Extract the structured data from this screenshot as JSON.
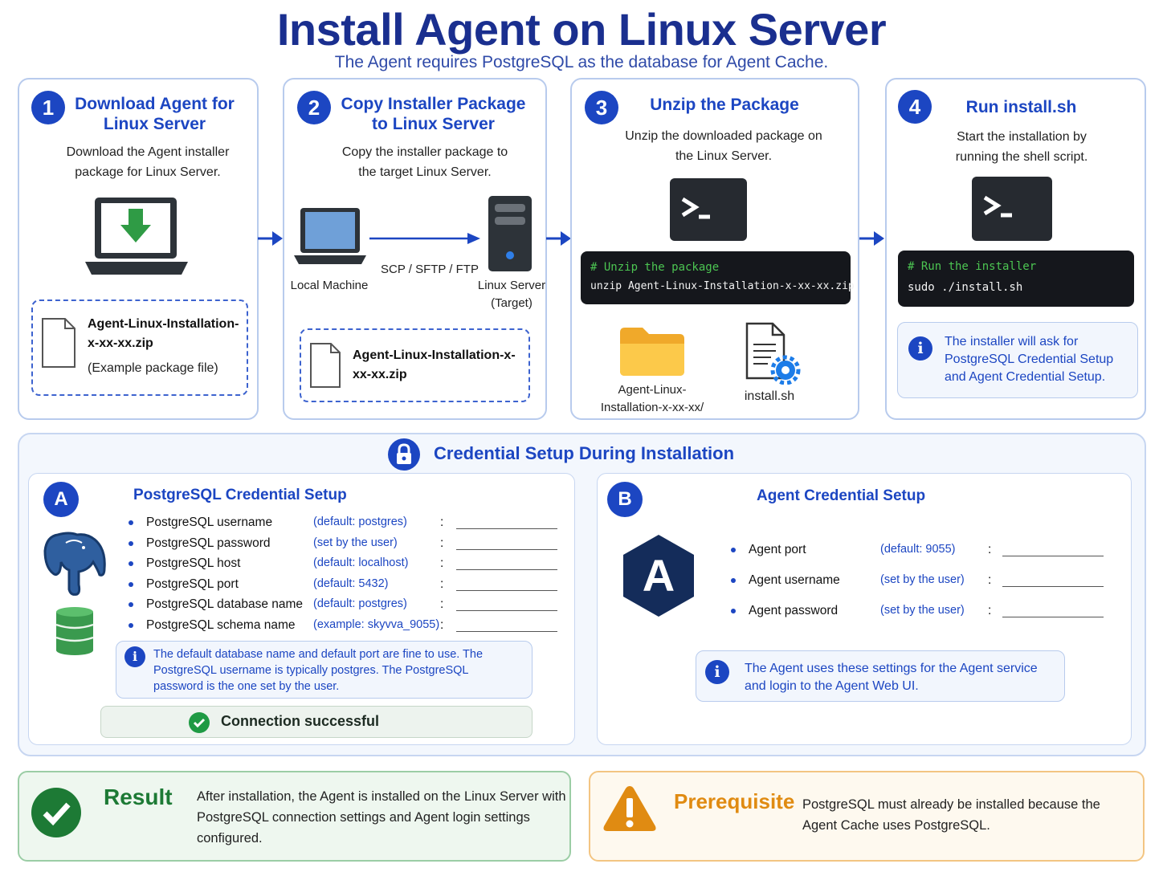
{
  "header": {
    "title": "Install Agent on Linux Server",
    "subtitle": "The Agent requires PostgreSQL as the database for Agent Cache."
  },
  "steps": [
    {
      "number": "1",
      "title": "Download Agent for Linux Server",
      "description": "Download the Agent installer package for Linux Server.",
      "file_name": "Agent-Linux-Installation-x-xx-xx.zip",
      "file_note": "(Example package file)",
      "icon": "laptop-download-icon"
    },
    {
      "number": "2",
      "title": "Copy Installer Package to Linux Server",
      "description": "Copy the installer package to the target Linux Server.",
      "local_label": "Local Machine",
      "transfer_label": "SCP / SFTP / FTP",
      "server_label": "Linux Server (Target)",
      "file_name": "Agent-Linux-Installation-x-xx-xx.zip"
    },
    {
      "number": "3",
      "title": "Unzip the Package",
      "description": "Unzip the downloaded package on the Linux Server.",
      "code_comment": "# Unzip the package",
      "code_command": "unzip Agent-Linux-Installation-x-xx-xx.zip",
      "folder_label": "Agent-Linux-Installation-x-xx-xx/",
      "script_label": "install.sh"
    },
    {
      "number": "4",
      "title": "Run install.sh",
      "description": "Start the installation by running the shell script.",
      "code_comment": "# Run the installer",
      "code_command": "sudo ./install.sh",
      "info": "The installer will ask for PostgreSQL Credential Setup and Agent Credential Setup."
    }
  ],
  "credential_setup": {
    "heading": "Credential Setup During Installation",
    "postgres": {
      "letter": "A",
      "title": "PostgreSQL Credential Setup",
      "fields": [
        {
          "name": "PostgreSQL username",
          "default": "(default: postgres)"
        },
        {
          "name": "PostgreSQL password",
          "default": "(set by the user)"
        },
        {
          "name": "PostgreSQL host",
          "default": "(default: localhost)"
        },
        {
          "name": "PostgreSQL port",
          "default": "(default: 5432)"
        },
        {
          "name": "PostgreSQL database name",
          "default": "(default: postgres)"
        },
        {
          "name": "PostgreSQL schema name",
          "default": "(example: skyvva_9055)"
        }
      ],
      "info": "The default database name and default port are fine to use. The PostgreSQL username is typically postgres.  The PostgreSQL password is the one set by the user.",
      "status": "Connection successful"
    },
    "agent": {
      "letter": "B",
      "title": "Agent Credential Setup",
      "logo_letter": "A",
      "fields": [
        {
          "name": "Agent port",
          "default": "(default: 9055)"
        },
        {
          "name": "Agent username",
          "default": "(set by the user)"
        },
        {
          "name": "Agent password",
          "default": "(set by the user)"
        }
      ],
      "info": "The Agent uses these settings for the Agent service and login to the Agent Web UI."
    },
    "colon": ":"
  },
  "result": {
    "title": "Result",
    "text": "After installation, the Agent is installed on the Linux Server with PostgreSQL connection settings and Agent login settings configured."
  },
  "prerequisite": {
    "title": "Prerequisite",
    "text": "PostgreSQL must already be installed because the Agent Cache uses PostgreSQL."
  },
  "colors": {
    "primary": "#1c46c2",
    "title": "#1a2f8f",
    "success": "#1f9a44",
    "warning": "#e08b12",
    "terminal": "#262a30"
  }
}
